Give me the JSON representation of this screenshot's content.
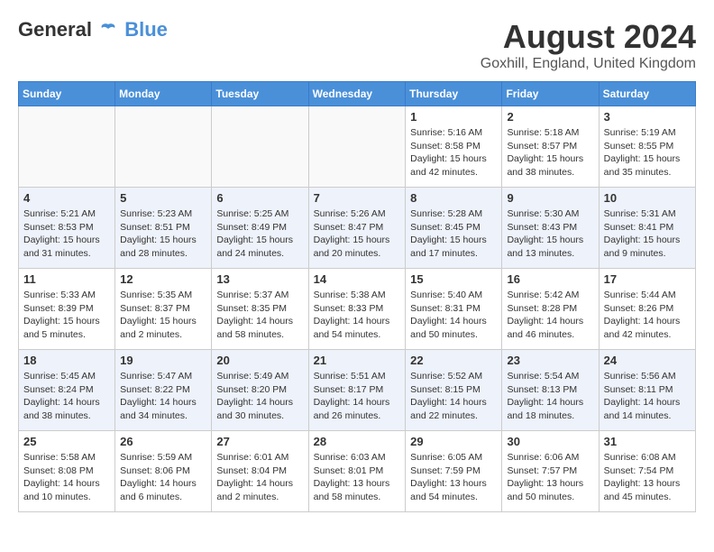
{
  "header": {
    "logo": {
      "general": "General",
      "blue": "Blue",
      "tagline": ""
    },
    "title": "August 2024",
    "location": "Goxhill, England, United Kingdom"
  },
  "weekdays": [
    "Sunday",
    "Monday",
    "Tuesday",
    "Wednesday",
    "Thursday",
    "Friday",
    "Saturday"
  ],
  "weeks": [
    {
      "days": [
        {
          "number": "",
          "info": ""
        },
        {
          "number": "",
          "info": ""
        },
        {
          "number": "",
          "info": ""
        },
        {
          "number": "",
          "info": ""
        },
        {
          "number": "1",
          "info": "Sunrise: 5:16 AM\nSunset: 8:58 PM\nDaylight: 15 hours\nand 42 minutes."
        },
        {
          "number": "2",
          "info": "Sunrise: 5:18 AM\nSunset: 8:57 PM\nDaylight: 15 hours\nand 38 minutes."
        },
        {
          "number": "3",
          "info": "Sunrise: 5:19 AM\nSunset: 8:55 PM\nDaylight: 15 hours\nand 35 minutes."
        }
      ]
    },
    {
      "days": [
        {
          "number": "4",
          "info": "Sunrise: 5:21 AM\nSunset: 8:53 PM\nDaylight: 15 hours\nand 31 minutes."
        },
        {
          "number": "5",
          "info": "Sunrise: 5:23 AM\nSunset: 8:51 PM\nDaylight: 15 hours\nand 28 minutes."
        },
        {
          "number": "6",
          "info": "Sunrise: 5:25 AM\nSunset: 8:49 PM\nDaylight: 15 hours\nand 24 minutes."
        },
        {
          "number": "7",
          "info": "Sunrise: 5:26 AM\nSunset: 8:47 PM\nDaylight: 15 hours\nand 20 minutes."
        },
        {
          "number": "8",
          "info": "Sunrise: 5:28 AM\nSunset: 8:45 PM\nDaylight: 15 hours\nand 17 minutes."
        },
        {
          "number": "9",
          "info": "Sunrise: 5:30 AM\nSunset: 8:43 PM\nDaylight: 15 hours\nand 13 minutes."
        },
        {
          "number": "10",
          "info": "Sunrise: 5:31 AM\nSunset: 8:41 PM\nDaylight: 15 hours\nand 9 minutes."
        }
      ]
    },
    {
      "days": [
        {
          "number": "11",
          "info": "Sunrise: 5:33 AM\nSunset: 8:39 PM\nDaylight: 15 hours\nand 5 minutes."
        },
        {
          "number": "12",
          "info": "Sunrise: 5:35 AM\nSunset: 8:37 PM\nDaylight: 15 hours\nand 2 minutes."
        },
        {
          "number": "13",
          "info": "Sunrise: 5:37 AM\nSunset: 8:35 PM\nDaylight: 14 hours\nand 58 minutes."
        },
        {
          "number": "14",
          "info": "Sunrise: 5:38 AM\nSunset: 8:33 PM\nDaylight: 14 hours\nand 54 minutes."
        },
        {
          "number": "15",
          "info": "Sunrise: 5:40 AM\nSunset: 8:31 PM\nDaylight: 14 hours\nand 50 minutes."
        },
        {
          "number": "16",
          "info": "Sunrise: 5:42 AM\nSunset: 8:28 PM\nDaylight: 14 hours\nand 46 minutes."
        },
        {
          "number": "17",
          "info": "Sunrise: 5:44 AM\nSunset: 8:26 PM\nDaylight: 14 hours\nand 42 minutes."
        }
      ]
    },
    {
      "days": [
        {
          "number": "18",
          "info": "Sunrise: 5:45 AM\nSunset: 8:24 PM\nDaylight: 14 hours\nand 38 minutes."
        },
        {
          "number": "19",
          "info": "Sunrise: 5:47 AM\nSunset: 8:22 PM\nDaylight: 14 hours\nand 34 minutes."
        },
        {
          "number": "20",
          "info": "Sunrise: 5:49 AM\nSunset: 8:20 PM\nDaylight: 14 hours\nand 30 minutes."
        },
        {
          "number": "21",
          "info": "Sunrise: 5:51 AM\nSunset: 8:17 PM\nDaylight: 14 hours\nand 26 minutes."
        },
        {
          "number": "22",
          "info": "Sunrise: 5:52 AM\nSunset: 8:15 PM\nDaylight: 14 hours\nand 22 minutes."
        },
        {
          "number": "23",
          "info": "Sunrise: 5:54 AM\nSunset: 8:13 PM\nDaylight: 14 hours\nand 18 minutes."
        },
        {
          "number": "24",
          "info": "Sunrise: 5:56 AM\nSunset: 8:11 PM\nDaylight: 14 hours\nand 14 minutes."
        }
      ]
    },
    {
      "days": [
        {
          "number": "25",
          "info": "Sunrise: 5:58 AM\nSunset: 8:08 PM\nDaylight: 14 hours\nand 10 minutes."
        },
        {
          "number": "26",
          "info": "Sunrise: 5:59 AM\nSunset: 8:06 PM\nDaylight: 14 hours\nand 6 minutes."
        },
        {
          "number": "27",
          "info": "Sunrise: 6:01 AM\nSunset: 8:04 PM\nDaylight: 14 hours\nand 2 minutes."
        },
        {
          "number": "28",
          "info": "Sunrise: 6:03 AM\nSunset: 8:01 PM\nDaylight: 13 hours\nand 58 minutes."
        },
        {
          "number": "29",
          "info": "Sunrise: 6:05 AM\nSunset: 7:59 PM\nDaylight: 13 hours\nand 54 minutes."
        },
        {
          "number": "30",
          "info": "Sunrise: 6:06 AM\nSunset: 7:57 PM\nDaylight: 13 hours\nand 50 minutes."
        },
        {
          "number": "31",
          "info": "Sunrise: 6:08 AM\nSunset: 7:54 PM\nDaylight: 13 hours\nand 45 minutes."
        }
      ]
    }
  ]
}
